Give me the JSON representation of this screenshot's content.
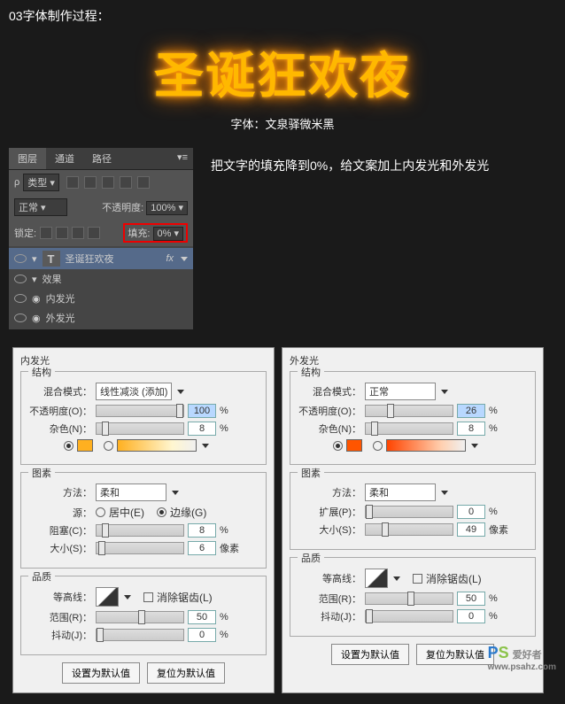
{
  "header": "03字体制作过程：",
  "hero": {
    "text": "圣诞狂欢夜",
    "sub": "字体：文泉驿微米黑"
  },
  "layers": {
    "tabs": [
      "图层",
      "通道",
      "路径"
    ],
    "kind": "类型",
    "blend": "正常",
    "opLabel": "不透明度:",
    "opVal": "100%",
    "lockLabel": "锁定:",
    "fillLabel": "填充:",
    "fillVal": "0%",
    "layerName": "圣诞狂欢夜",
    "fx": "fx",
    "effects": "效果",
    "innerGlow": "内发光",
    "outerGlow": "外发光"
  },
  "caption": "把文字的填充降到0%，给文案加上内发光和外发光",
  "inner": {
    "title": "内发光",
    "struct": "结构",
    "blendLabel": "混合模式：",
    "blendVal": "线性减淡 (添加)",
    "opLabel": "不透明度(O)：",
    "opVal": "100",
    "pct": "%",
    "noiseLabel": "杂色(N)：",
    "noiseVal": "8",
    "color": "#ffb020",
    "grad": "linear-gradient(90deg,#ffb020,#fff6d0)",
    "elements": "图素",
    "methodLabel": "方法：",
    "methodVal": "柔和",
    "sourceLabel": "源：",
    "sourceCenter": "居中(E)",
    "sourceEdge": "边缘(G)",
    "chokeLabel": "阻塞(C)：",
    "chokeVal": "8",
    "sizeLabel": "大小(S)：",
    "sizeVal": "6",
    "px": "像素",
    "quality": "品质",
    "contourLabel": "等高线：",
    "aa": "消除锯齿(L)",
    "rangeLabel": "范围(R)：",
    "rangeVal": "50",
    "jitterLabel": "抖动(J)：",
    "jitterVal": "0",
    "btnDefault": "设置为默认值",
    "btnReset": "复位为默认值"
  },
  "outer": {
    "title": "外发光",
    "struct": "结构",
    "blendLabel": "混合模式：",
    "blendVal": "正常",
    "opLabel": "不透明度(O)：",
    "opVal": "26",
    "pct": "%",
    "noiseLabel": "杂色(N)：",
    "noiseVal": "8",
    "color": "#ff5500",
    "grad": "linear-gradient(90deg,#ff4400,#ffd0b0)",
    "elements": "图素",
    "methodLabel": "方法：",
    "methodVal": "柔和",
    "spreadLabel": "扩展(P)：",
    "spreadVal": "0",
    "sizeLabel": "大小(S)：",
    "sizeVal": "49",
    "px": "像素",
    "quality": "品质",
    "contourLabel": "等高线：",
    "aa": "消除锯齿(L)",
    "rangeLabel": "范围(R)：",
    "rangeVal": "50",
    "jitterLabel": "抖动(J)：",
    "jitterVal": "0",
    "btnDefault": "设置为默认值",
    "btnReset": "复位为默认值"
  },
  "wm": {
    "p": "P",
    "s": "S",
    "t": "爱好者",
    "url": "www.psahz.com"
  }
}
